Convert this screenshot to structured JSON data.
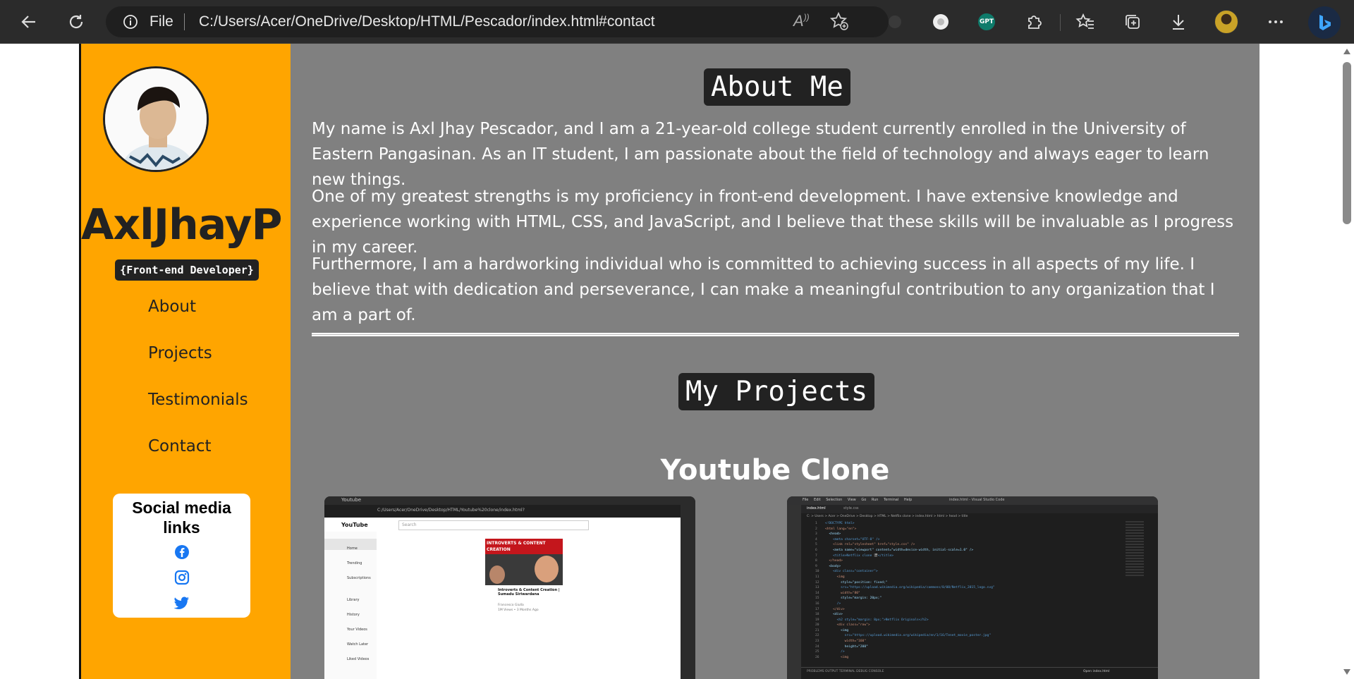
{
  "browser": {
    "protocol_label": "File",
    "url": "C:/Users/Acer/OneDrive/Desktop/HTML/Pescador/index.html#contact",
    "read_aloud_label": "A",
    "gpt_label": "GPT"
  },
  "sidebar": {
    "brand": "AxlJhayP",
    "role": "{Front-end Developer}",
    "nav": [
      {
        "label": "About"
      },
      {
        "label": "Projects"
      },
      {
        "label": "Testimonials"
      },
      {
        "label": "Contact"
      }
    ],
    "social": {
      "title": "Social media links",
      "icons": [
        "facebook-icon",
        "instagram-icon",
        "twitter-icon"
      ]
    }
  },
  "about": {
    "title": "About Me",
    "paragraphs": [
      "My name is Axl Jhay Pescador, and I am a 21-year-old college student currently enrolled in the University of Eastern Pangasinan. As an IT student, I am passionate about the field of technology and always eager to learn new things.",
      "One of my greatest strengths is my proficiency in front-end development. I have extensive knowledge and experience working with HTML, CSS, and JavaScript, and I believe that these skills will be invaluable as I progress in my career.",
      "Furthermore, I am a hardworking individual who is committed to achieving success in all aspects of my life. I believe that with dedication and perseverance, I can make a meaningful contribution to any organization that I am a part of."
    ]
  },
  "projects": {
    "title": "My Projects",
    "current": "Youtube Clone",
    "screenshot_left": {
      "tab": "Youtube",
      "url": "C:/Users/Acer/OneDrive/Desktop/HTML/Youtube%20clone/index.html?",
      "logo": "YouTube",
      "search": "Search",
      "menu": [
        "Home",
        "Trending",
        "Subscriptions",
        "Library",
        "History",
        "Your Videos",
        "Watch Later",
        "Liked Videos"
      ],
      "video_thumb": "INTROVERTS & CONTENT CREATION",
      "video_title": "Introverts & Content Creation | Sumadu Siriwardana",
      "video_meta": "Francesco Giulla",
      "video_stats": "1M Views • 3 Months Ago"
    },
    "screenshot_right": {
      "menu": [
        "File",
        "Edit",
        "Selection",
        "View",
        "Go",
        "Run",
        "Terminal",
        "Help"
      ],
      "window_title": "index.html - Visual Studio Code",
      "tabs": [
        "index.html",
        "style.css"
      ],
      "breadcrumb": "C: > Users > Acer > OneDrive > Desktop > HTML > Netflix clone > index.html > html > head > title",
      "code": [
        "<!DOCTYPE html>",
        "<html lang=\"en\">",
        "  <head>",
        "    <meta charset=\"UTF-8\" />",
        "    <link rel=\"stylesheet\" href=\"style.css\" />",
        "    <meta name=\"viewport\" content=\"width=device-width, initial-scale=1.0\" />",
        "    <title>Netflix clone 🎬</title>",
        "  </head>",
        "  <body>",
        "    <div class=\"container\">",
        "      <img",
        "        style=\"position: fixed;\"",
        "        src=\"https://upload.wikimedia.org/wikipedia/commons/0/08/Netflix_2015_logo.svg\"",
        "        width=\"80\"",
        "        style=\"margin: 20px;\"",
        "      />",
        "    </div>",
        "    <div>",
        "      <h2 style=\"margin: 8px;\">Netflix Originals</h2>",
        "      <div class=\"row\">",
        "        <img",
        "          src=\"https://upload.wikimedia.org/wikipedia/en/1/16/Tenet_movie_poster.jpg\"",
        "          width=\"160\"",
        "          height=\"200\"",
        "        />",
        "        <img"
      ],
      "status_left": "PROBLEMS  OUTPUT  TERMINAL  DEBUG CONSOLE",
      "status_right": "Open index.html"
    }
  },
  "colors": {
    "sidebar": "#ffa500",
    "main": "#808080",
    "chrome": "#2b2b2b"
  }
}
